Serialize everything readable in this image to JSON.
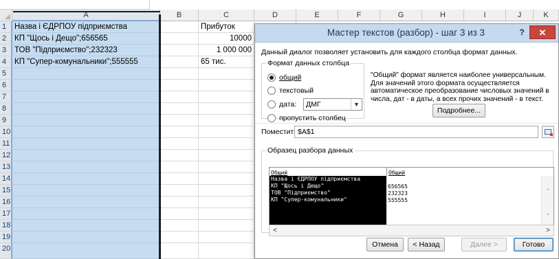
{
  "sheet": {
    "columns": [
      "A",
      "B",
      "C",
      "D",
      "E",
      "F",
      "G",
      "H",
      "I",
      "J",
      "K"
    ],
    "selected_column": "A",
    "rows": [
      "1",
      "2",
      "3",
      "4",
      "5",
      "6",
      "7",
      "8",
      "9",
      "10",
      "11",
      "12",
      "13",
      "14",
      "15",
      "16",
      "17",
      "18",
      "19",
      "20"
    ],
    "cells": {
      "A1": "Назва і ЄДРПОУ підприємства",
      "A2": "КП \"Щось і Дещо\";656565",
      "A3": "ТОВ \"Підприємство\";232323",
      "A4": "КП \"Супер-комунальники\";555555",
      "C1": "Прибуток",
      "C2": "10000",
      "C3": "1 000 000",
      "C4": "65 тис."
    }
  },
  "dialog": {
    "title": "Мастер текстов (разбор) - шаг 3 из 3",
    "help_label": "?",
    "close_label": "✕",
    "intro": "Данный диалог позволяет установить для каждого столбца формат данных.",
    "format_group_label": "Формат данных столбца",
    "radios": {
      "general": "общий",
      "text": "текстовый",
      "date": "дата:",
      "skip": "пропустить столбец"
    },
    "selected_radio": "general",
    "date_format_value": "ДМГ",
    "description": "\"Общий\" формат является наиболее универсальным. Для значений этого формата осуществляется автоматическое преобразование числовых значений в числа, дат - в даты, а всех прочих значений - в текст.",
    "details_button": "Подробнее...",
    "destination_label": "Поместить в:",
    "destination_value": "$A$1",
    "preview_group_label": "Образец разбора данных",
    "preview": {
      "col1_header": "Общий",
      "col2_header": "Общий",
      "col1_lines": [
        "Назва і ЄДРПОУ підприємства",
        "КП \"Щось і Дещо\"",
        "ТОВ \"Підприємство\"",
        "КП \"Супер-комунальники\""
      ],
      "col2_lines": [
        "656565",
        "232323",
        "555555"
      ]
    },
    "buttons": {
      "cancel": "Отмена",
      "back": "< Назад",
      "next": "Далее >",
      "finish": "Готово"
    },
    "colors": {
      "titlebar": "#c7d9ee",
      "close": "#c9463d",
      "selected_column_fill": "#c5dcf1"
    }
  }
}
